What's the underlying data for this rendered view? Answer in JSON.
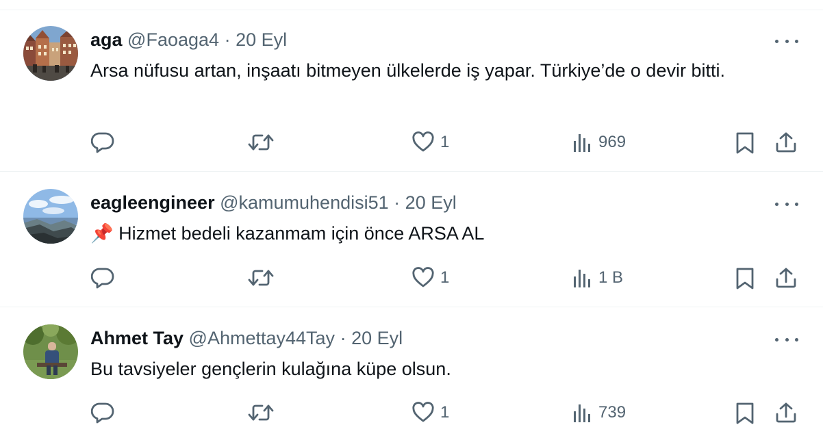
{
  "tweets": [
    {
      "name": "aga",
      "handle": "@Faoaga4",
      "separator": "·",
      "date": "20 Eyl",
      "text": "Arsa nüfusu artan, inşaatı bitmeyen ülkelerde iş yapar. Türkiye’de o devir bitti.",
      "likes": "1",
      "views": "969",
      "avatar_icon": "city-street-photo"
    },
    {
      "name": "eagleengineer",
      "handle": "@kamumuhendisi51",
      "separator": "·",
      "date": "20 Eyl",
      "emoji": "📌",
      "text": "Hizmet bedeli kazanmam için önce ARSA AL",
      "likes": "1",
      "views": "1 B",
      "avatar_icon": "mountain-sky-photo"
    },
    {
      "name": "Ahmet Tay",
      "handle": "@Ahmettay44Tay",
      "separator": "·",
      "date": "20 Eyl",
      "text": "Bu tavsiyeler gençlerin kulağına küpe olsun.",
      "likes": "1",
      "views": "739",
      "avatar_icon": "person-park-photo"
    }
  ],
  "colors": {
    "text": "#0f1419",
    "secondary": "#536471",
    "divider": "#eff3f4"
  },
  "icons": [
    "reply-icon",
    "retweet-icon",
    "like-icon",
    "views-icon",
    "bookmark-icon",
    "share-icon",
    "more-icon"
  ]
}
